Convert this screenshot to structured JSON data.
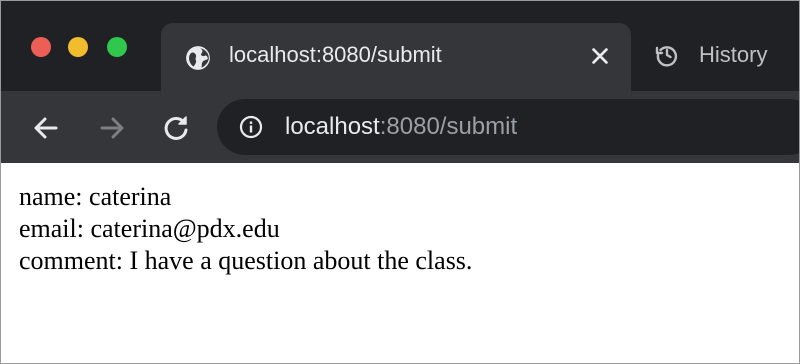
{
  "window": {
    "traffic_lights": {
      "close_color": "#ed5f56",
      "minimize_color": "#f1bd2e",
      "maximize_color": "#2fc74c"
    }
  },
  "tabs": {
    "active": {
      "title": "localhost:8080/submit",
      "icon": "globe-icon",
      "close_icon": "close-icon"
    },
    "inactive": {
      "title": "History",
      "icon": "history-icon"
    }
  },
  "toolbar": {
    "back_icon": "arrow-left-icon",
    "forward_icon": "arrow-right-icon",
    "reload_icon": "reload-icon"
  },
  "address_bar": {
    "info_icon": "info-icon",
    "host": "localhost",
    "rest": ":8080/submit"
  },
  "page": {
    "lines": [
      "name: caterina",
      "email: caterina@pdx.edu",
      "comment: I have a question about the class."
    ]
  },
  "colors": {
    "tabstrip_bg": "#202124",
    "toolbar_bg": "#35363a",
    "omnibox_bg": "#202124",
    "text_light": "#e8eaed",
    "text_muted": "#9aa0a6"
  }
}
